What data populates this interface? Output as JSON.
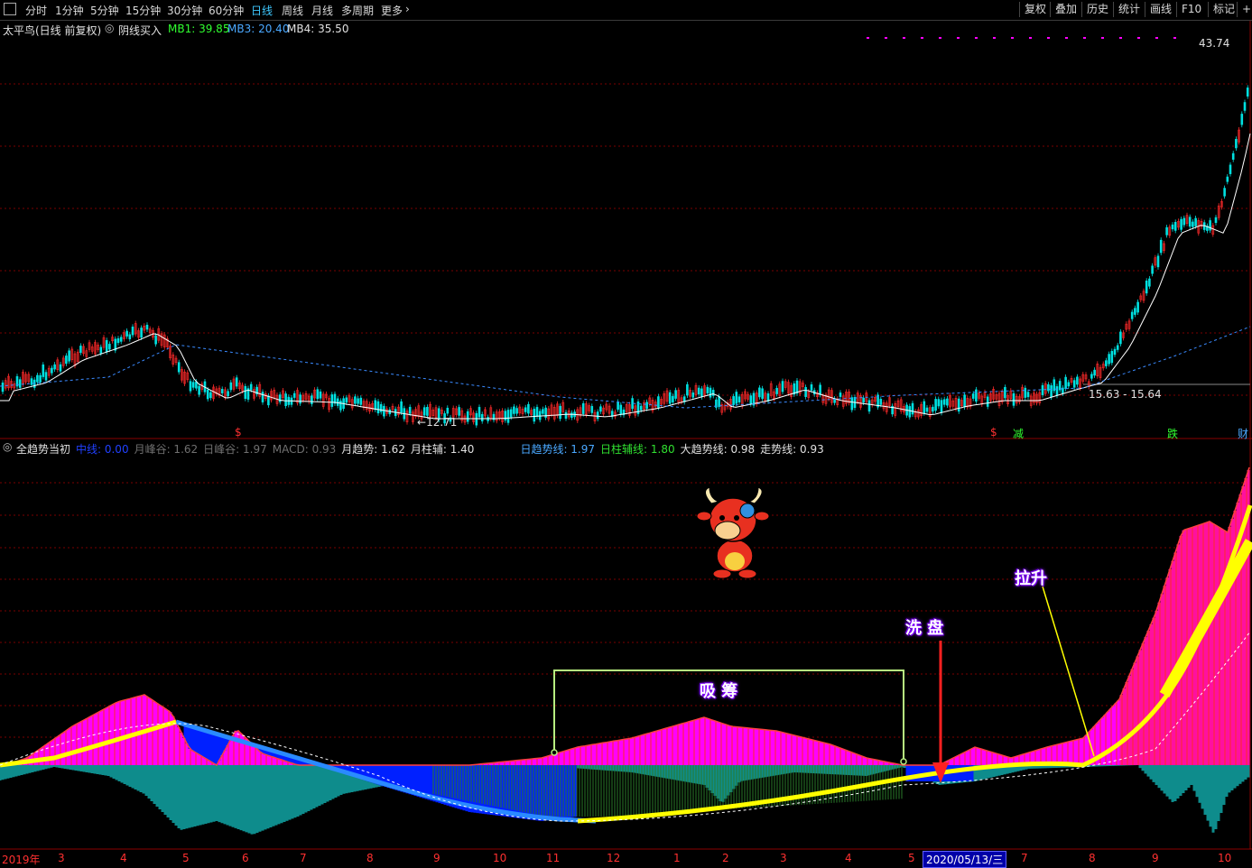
{
  "toolbar": {
    "periods": [
      "分时",
      "1分钟",
      "5分钟",
      "15分钟",
      "30分钟",
      "60分钟",
      "日线",
      "周线",
      "月线",
      "多周期",
      "更多"
    ],
    "active_period": "日线",
    "right_buttons": [
      "复权",
      "叠加",
      "历史",
      "统计",
      "画线",
      "F10",
      "标记",
      "+自"
    ]
  },
  "main_panel": {
    "title": "太平鸟(日线 前复权)",
    "indicator_name": "阴线买入",
    "mb1_label": "MB1:",
    "mb1_value": "39.85",
    "mb3_label": "MB3:",
    "mb3_value": "20.40",
    "mb4_label": "MB4:",
    "mb4_value": "35.50",
    "high_label": "43.74",
    "low_label": "12.71",
    "range_label": "15.63 - 15.64",
    "event_markers": [
      "$",
      "$",
      "减",
      "跌",
      "财"
    ]
  },
  "sub_panel": {
    "indicator_name": "全趋势当初",
    "items": [
      {
        "label": "中线:",
        "value": "0.00",
        "color": "#2040ff"
      },
      {
        "label": "月峰谷:",
        "value": "1.62",
        "color": "#707070"
      },
      {
        "label": "日峰谷:",
        "value": "1.97",
        "color": "#707070"
      },
      {
        "label": "MACD:",
        "value": "0.93",
        "color": "#707070"
      },
      {
        "label": "月趋势:",
        "value": "1.62",
        "color": "#e0e0e0"
      },
      {
        "label": "月柱辅:",
        "value": "1.40",
        "color": "#e0e0e0"
      },
      {
        "label": "日趋势线:",
        "value": "1.97",
        "color": "#4aa8ff"
      },
      {
        "label": "日柱辅线:",
        "value": "1.80",
        "color": "#30e030"
      },
      {
        "label": "大趋势线:",
        "value": "0.98",
        "color": "#e0e0e0"
      },
      {
        "label": "走势线:",
        "value": "0.93",
        "color": "#e0e0e0"
      }
    ],
    "annotations": {
      "accumulate": "吸 筹",
      "washout": "洗 盘",
      "lift": "拉升"
    }
  },
  "x_axis": {
    "ticks": [
      "2019年",
      "3",
      "4",
      "5",
      "6",
      "7",
      "8",
      "9",
      "10",
      "11",
      "12",
      "1",
      "2",
      "3",
      "4",
      "5",
      "7",
      "8",
      "9",
      "10"
    ],
    "highlighted_date": "2020/05/13/三"
  },
  "colors": {
    "up": "#ff2a2a",
    "down": "#00e0e0",
    "magenta": "#ff00ff",
    "blue": "#0020ff",
    "yellow": "#ffff00",
    "teal": "#008080",
    "green": "#00a000"
  }
}
